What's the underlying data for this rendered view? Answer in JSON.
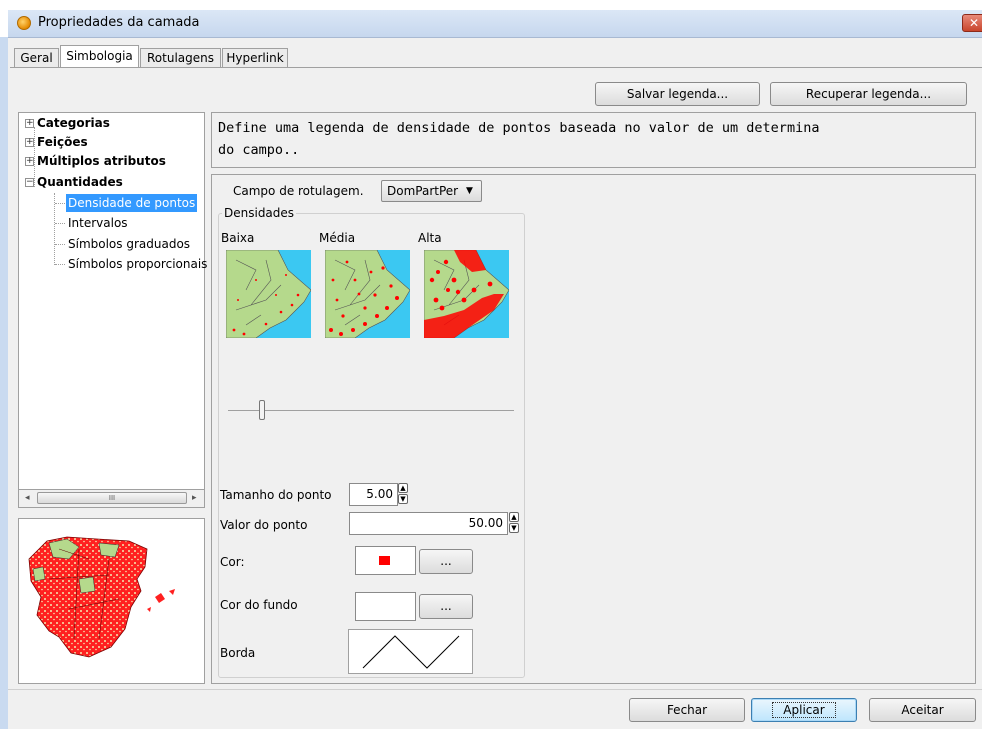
{
  "window": {
    "title": "Propriedades da camada",
    "close_icon": "close-icon"
  },
  "tabs": [
    {
      "label": "Geral"
    },
    {
      "label": "Simbologia",
      "active": true
    },
    {
      "label": "Rotulagens"
    },
    {
      "label": "Hyperlink"
    }
  ],
  "toolbar": {
    "save_legend": "Salvar legenda...",
    "recover_legend": "Recuperar legenda..."
  },
  "tree": {
    "items": [
      {
        "label": "Categorias",
        "bold": true,
        "expander": "+"
      },
      {
        "label": "Feições",
        "bold": true,
        "expander": "+"
      },
      {
        "label": "Múltiplos atributos",
        "bold": true,
        "expander": "+"
      },
      {
        "label": "Quantidades",
        "bold": true,
        "expander": "−"
      },
      {
        "label": "Densidade de pontos",
        "selected": true
      },
      {
        "label": "Intervalos"
      },
      {
        "label": "Símbolos graduados"
      },
      {
        "label": "Símbolos proporcionais"
      }
    ],
    "scroll_thumb": "III"
  },
  "description": {
    "line1": "Define uma legenda de densidade de pontos baseada no valor de um determina",
    "line2": "do campo.."
  },
  "form": {
    "field_label": "Campo de rotulagem.",
    "field_value": "DomPartPer",
    "densities_group": "Densidades",
    "density_low": "Baixa",
    "density_mid": "Média",
    "density_high": "Alta",
    "slider_level": 0.12,
    "point_size_label": "Tamanho do ponto",
    "point_size_value": "5.00",
    "point_value_label": "Valor do ponto",
    "point_value_value": "50.00",
    "color_label": "Cor:",
    "color_value": "#ff0000",
    "bg_color_label": "Cor do fundo",
    "border_label": "Borda",
    "ellipsis": "..."
  },
  "footer": {
    "close": "Fechar",
    "apply": "Aplicar",
    "accept": "Aceitar"
  },
  "colors": {
    "map_sea": "#3bc8f2",
    "map_land": "#b5d98c",
    "dots": "#ff0000",
    "selection": "#3399ff"
  }
}
